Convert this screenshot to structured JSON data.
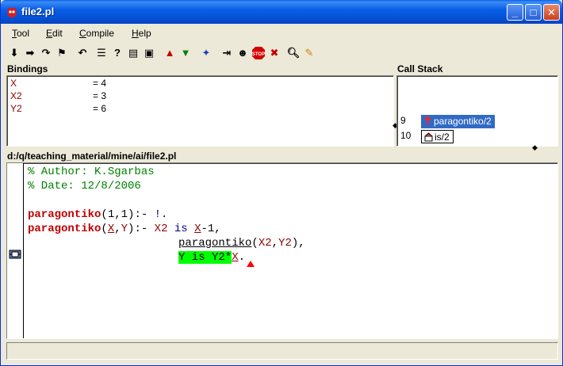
{
  "window": {
    "title": "file2.pl",
    "controls": [
      "minimize",
      "maximize",
      "close"
    ]
  },
  "menu": [
    {
      "label": "Tool",
      "mnemonic": "T"
    },
    {
      "label": "Edit",
      "mnemonic": "E"
    },
    {
      "label": "Compile",
      "mnemonic": "C"
    },
    {
      "label": "Help",
      "mnemonic": "H"
    }
  ],
  "toolbar": {
    "icons": [
      "creep-icon",
      "skip-icon",
      "leap-icon",
      "abort-icon",
      "undo-icon",
      "finish-icon",
      "query-icon",
      "edit-icon",
      "print-icon",
      "up-icon",
      "down-icon",
      "butterfly-icon",
      "spy-icon",
      "stop-icon",
      "nodebug-icon",
      "find-icon",
      "edit-pen-icon"
    ]
  },
  "bindings": {
    "label": "Bindings",
    "rows": [
      {
        "name": "X",
        "value": "= 4"
      },
      {
        "name": "X2",
        "value": "= 3"
      },
      {
        "name": "Y2",
        "value": "= 6"
      }
    ]
  },
  "call_stack": {
    "label": "Call Stack",
    "frames": [
      {
        "level": "9",
        "goal": "paragontiko/2",
        "selected": true
      },
      {
        "level": "10",
        "goal": "is/2",
        "selected": false
      }
    ]
  },
  "editor": {
    "path": "d:/q/teaching_material/mine/ai/file2.pl",
    "lines": {
      "l1": "% Author: K.Sgarbas",
      "l2": "% Date: 12/8/2006",
      "l4_head": "paragontiko",
      "l4_args": "(1,1)",
      "l4_neck": ":- ",
      "l4_body": "!.",
      "l5_head": "paragontiko",
      "l5_open": "(",
      "l5_x": "X",
      "l5_comma": ",",
      "l5_y": "Y",
      "l5_close": ")",
      "l5_neck": ":- ",
      "l5_x2": "X2",
      "l5_is": " is ",
      "l5_rest": "-1,",
      "l6_call": "paragontiko",
      "l6_open": "(",
      "l6_x2": "X2",
      "l6_comma": ",",
      "l6_y2": "Y2",
      "l6_close": "),",
      "l7_goal": "Y is Y2*",
      "l7_x": "X",
      "l7_end": "."
    }
  }
}
